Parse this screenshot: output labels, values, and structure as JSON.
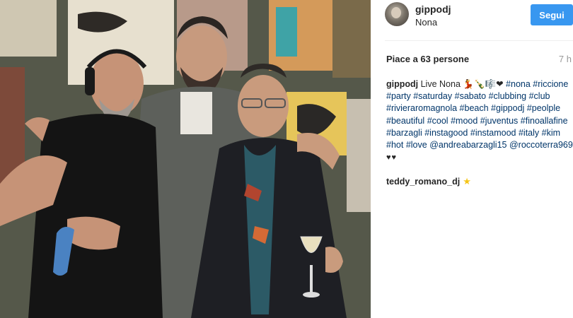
{
  "post": {
    "image_alt": "Three men posing in a club",
    "header": {
      "username": "gippodj",
      "location": "Nona",
      "follow_label": "Segui"
    },
    "likes_text": "Piace a 63 persone",
    "time_ago": "7 h",
    "caption": {
      "username": "gippodj",
      "text": "Live Nona",
      "emojis": "💃🍾🎼❤",
      "tags": [
        "#nona",
        "#riccione",
        "#party",
        "#saturday",
        "#sabato",
        "#clubbing",
        "#club",
        "#rivieraromagnola",
        "#beach",
        "#gippodj",
        "#peolple",
        "#beautiful",
        "#cool",
        "#mood",
        "#juventus",
        "#finoallafine",
        "#barzagli",
        "#instagood",
        "#instamood",
        "#italy",
        "#kim",
        "#hot",
        "#love"
      ],
      "mentions": [
        "@andreabarzagli15",
        "@roccoterra969"
      ],
      "trailing": "♥♥"
    },
    "comment": {
      "username": "teddy_romano_dj",
      "icon": "star-icon"
    },
    "colors": {
      "follow_button": "#3897f0",
      "hashtag": "#003569",
      "text": "#262626",
      "muted": "#999999"
    }
  }
}
